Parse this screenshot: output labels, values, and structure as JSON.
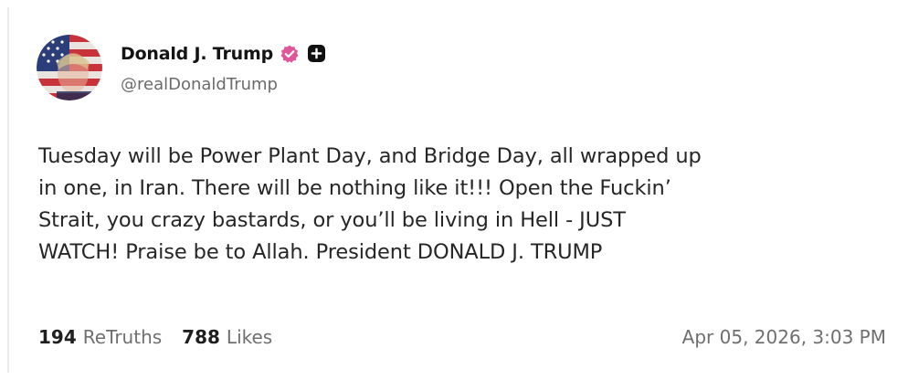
{
  "post": {
    "author": {
      "display_name": "Donald J. Trump",
      "handle": "@realDonaldTrump",
      "avatar": "flag-portrait-avatar",
      "verified_badge_icon": "verified-badge-icon",
      "verified_badge_color": "#e0569b",
      "secondary_badge_icon": "plus-badge-icon",
      "secondary_badge_color": "#111111"
    },
    "text": "Tuesday will be Power Plant Day, and Bridge Day, all wrapped up\nin one, in Iran. There will be nothing like it!!! Open the Fuckin’\nStrait, you crazy bastards, or you’ll be living in Hell - JUST\nWATCH! Praise be to Allah. President DONALD J. TRUMP",
    "stats": {
      "retruths_count": "194",
      "retruths_label": "ReTruths",
      "likes_count": "788",
      "likes_label": "Likes"
    },
    "timestamp": "Apr 05, 2026, 3:03 PM"
  }
}
